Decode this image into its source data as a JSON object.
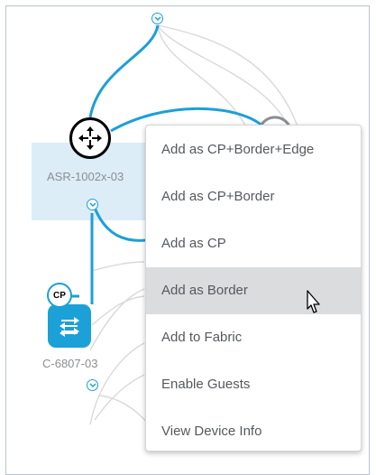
{
  "topology": {
    "router": {
      "label": "ASR-1002x-03",
      "icon": "router-icon"
    },
    "switch": {
      "label": "C-6807-03",
      "icon": "switch-icon",
      "badge": "CP"
    }
  },
  "context_menu": {
    "items": [
      {
        "label": "Add as CP+Border+Edge"
      },
      {
        "label": "Add as CP+Border"
      },
      {
        "label": "Add as CP"
      },
      {
        "label": "Add as Border"
      },
      {
        "label": "Add to Fabric"
      },
      {
        "label": "Enable Guests"
      },
      {
        "label": "View Device Info"
      }
    ],
    "hovered_index": 3
  },
  "colors": {
    "accent": "#1ba0d7",
    "selection": "#dcedf8",
    "link_inactive": "#d9d9d9",
    "menu_hover": "#dadcde"
  }
}
